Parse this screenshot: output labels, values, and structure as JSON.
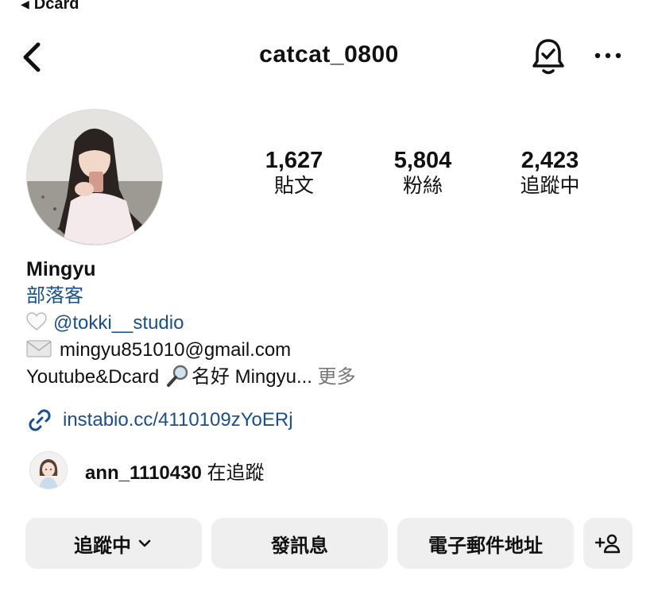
{
  "status": {
    "back_label": "Dcard"
  },
  "header": {
    "username": "catcat_0800"
  },
  "stats": [
    {
      "value": "1,627",
      "label": "貼文"
    },
    {
      "value": "5,804",
      "label": "粉絲"
    },
    {
      "value": "2,423",
      "label": "追蹤中"
    }
  ],
  "bio": {
    "name": "Mingyu",
    "category": "部落客",
    "mention": "@tokki__studio",
    "email": "mingyu851010@gmail.com",
    "line_prefix": "Youtube&Dcard ",
    "line_suffix": "名好 Mingyu...",
    "more": " 更多"
  },
  "link": {
    "text": "instabio.cc/4110109zYoERj"
  },
  "followed_by": {
    "handle": "ann_1110430",
    "suffix": " 在追蹤"
  },
  "actions": {
    "following": "追蹤中",
    "message": "發訊息",
    "email": "電子郵件地址"
  },
  "colors": {
    "link": "#1b4f8a",
    "button_bg": "#efefef"
  }
}
